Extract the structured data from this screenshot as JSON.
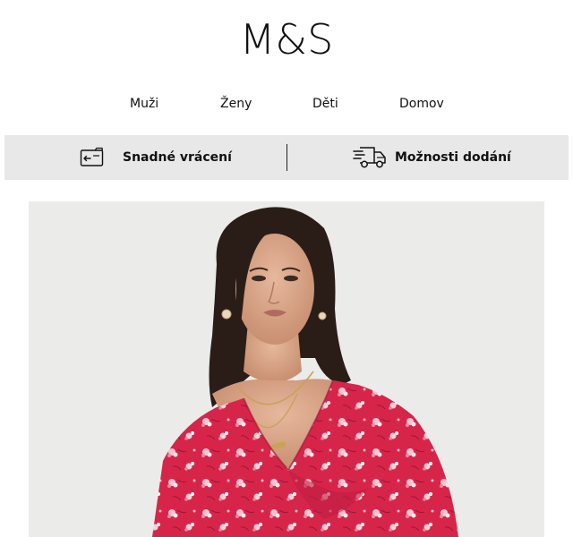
{
  "brand": {
    "logo_text": "M&S"
  },
  "nav": {
    "items": [
      {
        "label": "Muži"
      },
      {
        "label": "Ženy"
      },
      {
        "label": "Děti"
      },
      {
        "label": "Domov"
      }
    ]
  },
  "service_bar": {
    "returns": {
      "label": "Snadné vrácení",
      "icon": "return-parcel-icon"
    },
    "delivery": {
      "label": "Možnosti dodání",
      "icon": "delivery-truck-icon"
    }
  },
  "hero": {
    "image": "model-in-red-floral-dress",
    "colors": {
      "background": "#ebebea",
      "dress": "#d7254a",
      "hair": "#2a1d17",
      "skin": "#d9a88c"
    }
  }
}
